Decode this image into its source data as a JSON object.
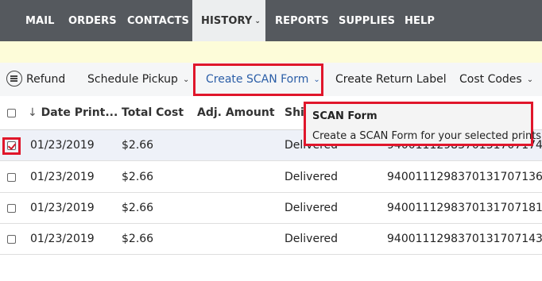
{
  "nav": {
    "items": [
      {
        "label": "MAIL"
      },
      {
        "label": "ORDERS"
      },
      {
        "label": "CONTACTS"
      },
      {
        "label": "HISTORY",
        "active": true
      },
      {
        "label": "REPORTS"
      },
      {
        "label": "SUPPLIES"
      },
      {
        "label": "HELP"
      }
    ]
  },
  "toolbar": {
    "refund_label": "Refund",
    "schedule_pickup_label": "Schedule Pickup",
    "create_scan_form_label": "Create SCAN Form",
    "create_return_label_label": "Create Return Label",
    "cost_codes_label": "Cost Codes"
  },
  "table": {
    "columns": {
      "date_printed": "Date Print...",
      "total_cost": "Total Cost",
      "adj_amount": "Adj. Amount",
      "ship": "Ship"
    },
    "rows": [
      {
        "date": "01/23/2019",
        "cost": "$2.66",
        "status": "Delivered",
        "tracking": "9400111298370131707174",
        "checked": true
      },
      {
        "date": "01/23/2019",
        "cost": "$2.66",
        "status": "Delivered",
        "tracking": "9400111298370131707136",
        "checked": false
      },
      {
        "date": "01/23/2019",
        "cost": "$2.66",
        "status": "Delivered",
        "tracking": "9400111298370131707181",
        "checked": false
      },
      {
        "date": "01/23/2019",
        "cost": "$2.66",
        "status": "Delivered",
        "tracking": "9400111298370131707143",
        "checked": false
      }
    ]
  },
  "tooltip": {
    "title": "SCAN Form",
    "body": "Create a SCAN Form for your selected prints."
  },
  "colors": {
    "nav_bg": "#55595e",
    "highlight_red": "#e0162b",
    "link_blue": "#2b5ea7"
  }
}
